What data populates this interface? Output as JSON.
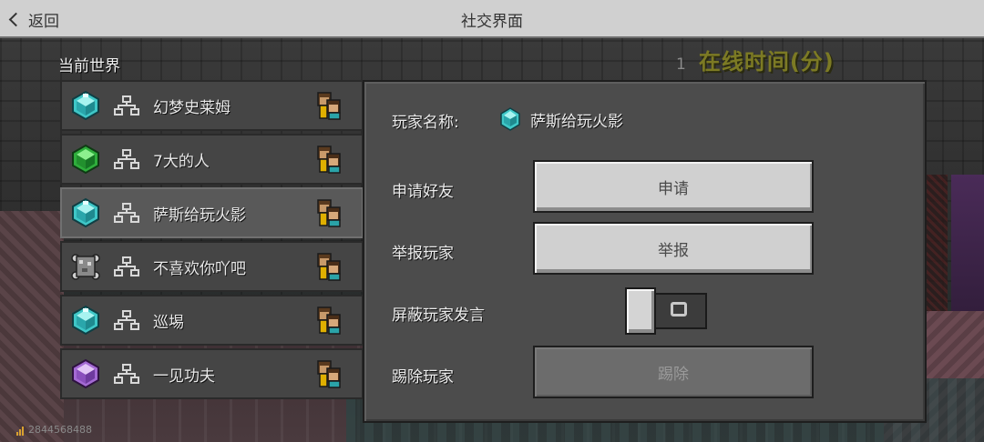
{
  "header": {
    "back_label": "返回",
    "title": "社交界面"
  },
  "world_overlay": {
    "number": "1",
    "label": "在线时间(分)"
  },
  "list": {
    "section_label": "当前世界",
    "players": [
      {
        "name": "幻梦史莱姆",
        "gem": "diamond-gem-icon",
        "selected": false
      },
      {
        "name": "7大的人",
        "gem": "emerald-gem-icon",
        "selected": false
      },
      {
        "name": "萨斯给玩火影",
        "gem": "diamond-gem-icon",
        "selected": true
      },
      {
        "name": "不喜欢你吖吧",
        "gem": "command-block-icon",
        "selected": false
      },
      {
        "name": "巡埸",
        "gem": "diamond-gem-icon",
        "selected": false
      },
      {
        "name": "一见功夫",
        "gem": "amethyst-gem-icon",
        "selected": false
      }
    ]
  },
  "detail": {
    "player_name_label": "玩家名称:",
    "player_name": "萨斯给玩火影",
    "add_friend_label": "申请好友",
    "add_friend_button": "申请",
    "report_label": "举报玩家",
    "report_button": "举报",
    "mute_label": "屏蔽玩家发言",
    "mute_enabled": false,
    "kick_label": "踢除玩家",
    "kick_button": "踢除"
  },
  "footer": {
    "id_text": "2844568488"
  },
  "colors": {
    "titlebar": "#d0d0d0",
    "panel": "#4c4c4c",
    "row": "#454545",
    "row_selected": "#595959",
    "button": "#d0d0d0",
    "button_disabled": "#6c6c6c",
    "overlay_text": "#7c7a24"
  }
}
